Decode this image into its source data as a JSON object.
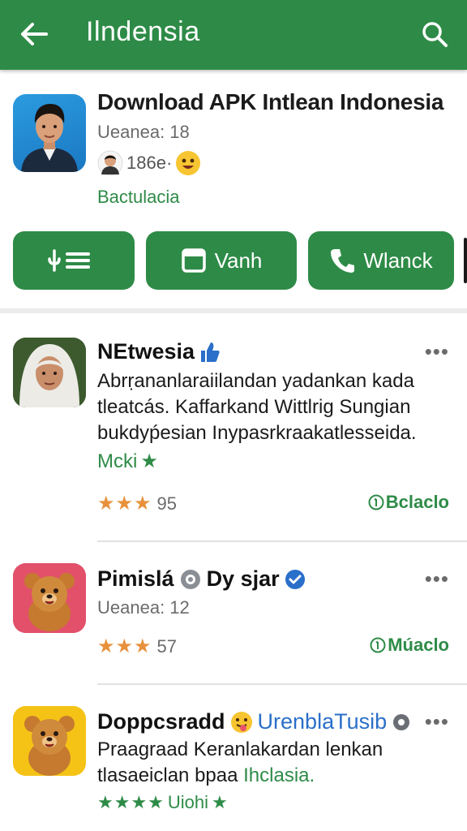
{
  "colors": {
    "brand_green": "#2e8b47",
    "star_orange": "#e8913c",
    "verified_blue": "#2a6fc9",
    "muted_text": "#6b6b6b"
  },
  "appbar": {
    "title": "Ilndensia",
    "back_icon": "arrow-left-icon",
    "search_icon": "search-icon"
  },
  "app": {
    "title": "Download APK Intlean Indonesia",
    "meta": "Ueanea: 18",
    "rating_text": "186e·",
    "developer": "Bactulacia",
    "icon": "person-portrait-icon"
  },
  "buttons": [
    {
      "label": "",
      "icon": "list-icon"
    },
    {
      "label": "Vanh",
      "icon": "square-window-icon"
    },
    {
      "label": "Wlanck",
      "icon": "phone-icon"
    }
  ],
  "items": [
    {
      "name": "NEtwesia",
      "badge_icon": "thumbs-up-icon",
      "description": "Abrṛananlaraiilandan yadankan kada tleatcás. Kaffarkand Wittlrig Sungian bukdyṕesian Inypasrkraakatlesseida.",
      "tag": "Mcki",
      "rating": 3,
      "count": "95",
      "action": "Bclaclo",
      "more": "•••"
    },
    {
      "name": "Pimislá",
      "name_suffix": "Dy sjar",
      "badge_icon": "verified-check-icon",
      "meta": "Ueanea: 12",
      "rating": 3,
      "count": "57",
      "action": "Múaclo",
      "more": "•••"
    },
    {
      "name": "Doppcsradd",
      "link_text": "UrenblaTusib",
      "description_a": "Praagraad Keranlakardan lenkan",
      "description_b": "tlasaeiclan bpaa",
      "description_highlight": "Ihclasia.",
      "rating": 4,
      "tag": "Uiohi",
      "more": "•••"
    }
  ]
}
